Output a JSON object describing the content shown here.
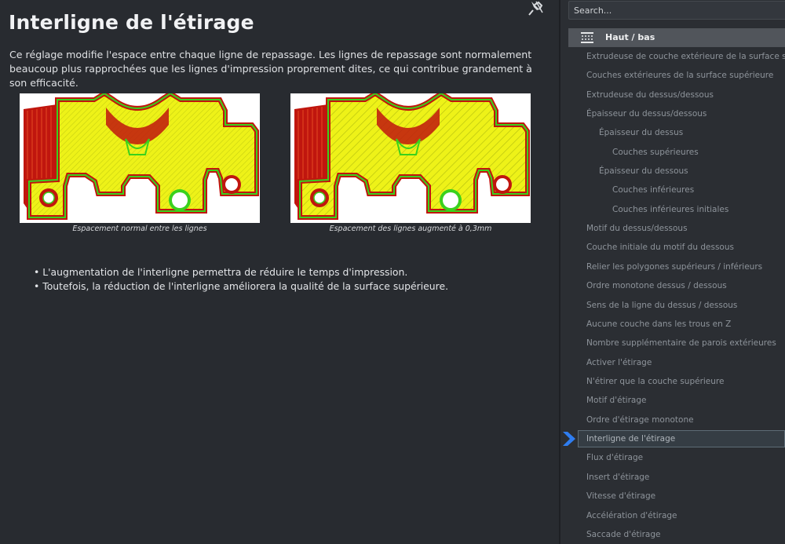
{
  "help": {
    "title": "Interligne de l'étirage",
    "description": "Ce réglage modifie l'espace entre chaque ligne de repassage. Les lignes de repassage sont normalement beaucoup plus rapprochées que les lignes d'impression proprement dites, ce qui contribue grandement à son efficacité.",
    "figures": [
      {
        "caption": "Espacement normal entre les lignes"
      },
      {
        "caption": "Espacement des lignes augmenté à 0,3mm"
      }
    ],
    "bullets": [
      "L'augmentation de l'interligne permettra de réduire le temps d'impression.",
      "Toutefois, la réduction de l'interligne améliorera la qualité de la surface supérieure."
    ]
  },
  "search": {
    "placeholder": "Search..."
  },
  "section": {
    "label": "Haut / bas"
  },
  "settings": [
    "Extrudeuse de couche extérieure de la surface supérieure",
    "Couches extérieures de la surface supérieure",
    "Extrudeuse du dessus/dessous",
    "Épaisseur du dessus/dessous",
    "Épaisseur du dessus",
    "Couches supérieures",
    "Épaisseur du dessous",
    "Couches inférieures",
    "Couches inférieures initiales",
    "Motif du dessus/dessous",
    "Couche initiale du motif du dessous",
    "Relier les polygones supérieurs / inférieurs",
    "Ordre monotone dessus / dessous",
    "Sens de la ligne du dessus / dessous",
    "Aucune couche dans les trous en Z",
    "Nombre supplémentaire de parois extérieures",
    "Activer l'étirage",
    "N'étirer que la couche supérieure",
    "Motif d'étirage",
    "Ordre d'étirage monotone",
    "Interligne de l'étirage",
    "Flux d'étirage",
    "Insert d'étirage",
    "Vitesse d'étirage",
    "Accélération d'étirage",
    "Saccade d'étirage"
  ],
  "selected_setting": "Interligne de l'étirage",
  "colors": {
    "accent_arrow": "#2f7df0",
    "part_fill": "#e9f019",
    "part_outline": "#3ad11c",
    "part_wall": "#c0160e"
  }
}
